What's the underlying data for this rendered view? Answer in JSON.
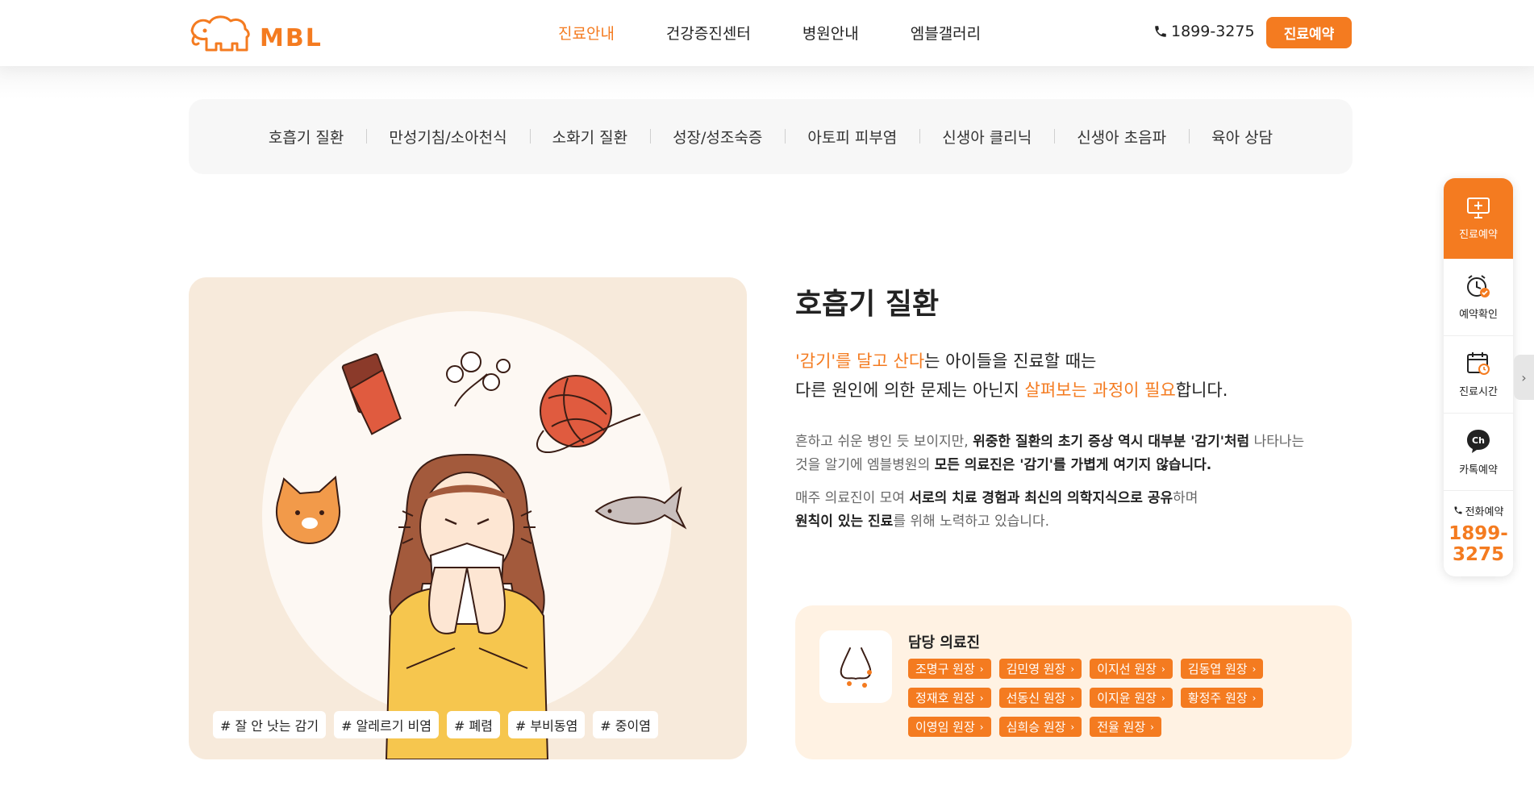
{
  "brand": {
    "logo_text": "MBL",
    "accent": "#f47b20"
  },
  "header": {
    "nav": [
      {
        "label": "진료안내",
        "active": true
      },
      {
        "label": "건강증진센터",
        "active": false
      },
      {
        "label": "병원안내",
        "active": false
      },
      {
        "label": "엠블갤러리",
        "active": false
      }
    ],
    "phone": "1899-3275",
    "reserve_label": "진료예약"
  },
  "subnav": {
    "items": [
      "호흡기 질환",
      "만성기침/소아천식",
      "소화기 질환",
      "성장/성조숙증",
      "아토피 피부염",
      "신생아 클리닉",
      "신생아 초음파",
      "육아 상담"
    ]
  },
  "image_card": {
    "tags": [
      "# 잘 안 낫는 감기",
      "# 알레르기 비염",
      "# 폐렴",
      "# 부비동염",
      "# 중이염"
    ]
  },
  "content": {
    "title": "호흡기 질환",
    "lead_line1_hl": "'감기'를 달고 산다",
    "lead_line1_rest": "는 아이들을 진료할 때는",
    "lead_line2_pre": "다른 원인에 의한 문제는 아닌지 ",
    "lead_line2_hl": "살펴보는 과정이 필요",
    "lead_line2_post": "합니다.",
    "desc1_a": "흔하고 쉬운 병인 듯 보이지만, ",
    "desc1_b": "위중한 질환의 초기 증상 역시 대부분 '감기'처럼",
    "desc1_c": " 나타나는",
    "desc1_d": "것을 알기에 엠블병원의 ",
    "desc1_e": "모든 의료진은 '감기'를 가볍게 여기지 않습니다.",
    "desc2_a": "매주 의료진이 모여 ",
    "desc2_b": "서로의 치료 경험과 최신의 의학지식으로 공유",
    "desc2_c": "하며",
    "desc2_d": "원칙이 있는 진료",
    "desc2_e": "를 위해 노력하고 있습니다."
  },
  "doctors": {
    "title": "담당 의료진",
    "list": [
      "조명구 원장",
      "김민영 원장",
      "이지선 원장",
      "김동엽 원장",
      "정재호 원장",
      "선동신 원장",
      "이지윤 원장",
      "황정주 원장",
      "이영임 원장",
      "심희승 원장",
      "전율 원장"
    ]
  },
  "quick_menu": {
    "items": [
      {
        "label": "진료예약",
        "icon": "monitor-plus-icon"
      },
      {
        "label": "예약확인",
        "icon": "alarm-check-icon"
      },
      {
        "label": "진료시간",
        "icon": "calendar-clock-icon"
      },
      {
        "label": "카톡예약",
        "icon": "kakao-channel-icon"
      }
    ],
    "phone_label": "전화예약",
    "phone_line1": "1899-",
    "phone_line2": "3275"
  }
}
